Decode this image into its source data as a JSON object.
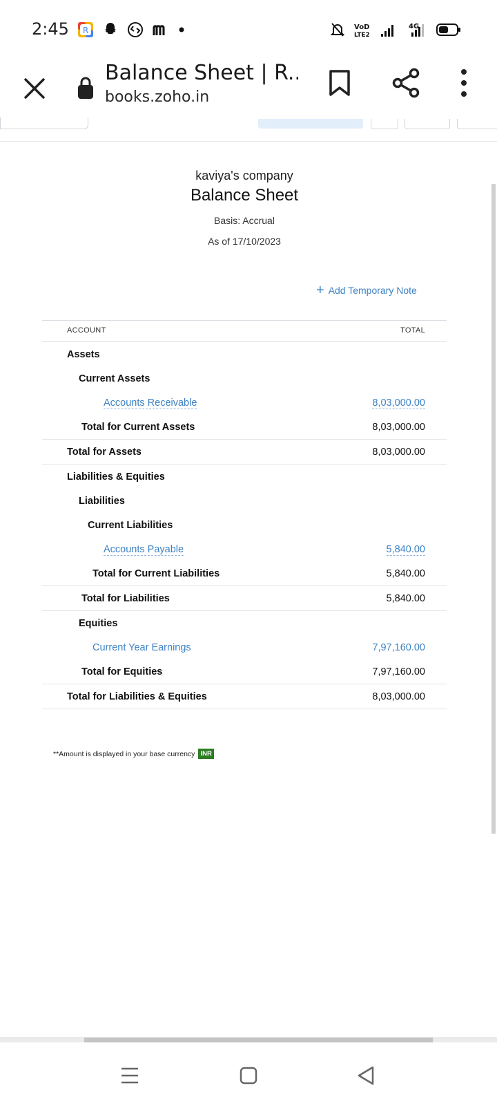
{
  "status_bar": {
    "time": "2:45",
    "left_icons": [
      "app-r-icon",
      "snapchat-icon",
      "shazam-icon",
      "m-app-icon",
      "dot-icon"
    ],
    "right_icons": [
      "bell-muted-icon",
      "volte-icon",
      "signal-icon",
      "4g-signal-icon",
      "battery-icon"
    ],
    "volte_label": "VoD\nLTE2",
    "network_label": "4G"
  },
  "browser": {
    "title": "Balance Sheet | R...",
    "url": "books.zoho.in"
  },
  "report": {
    "company": "kaviya's company",
    "title": "Balance Sheet",
    "basis": "Basis: Accrual",
    "as_of": "As of 17/10/2023",
    "add_note": "Add Temporary Note",
    "columns": {
      "account": "ACCOUNT",
      "total": "TOTAL"
    },
    "rows": {
      "assets": "Assets",
      "current_assets": "Current Assets",
      "accounts_receivable": {
        "label": "Accounts Receivable",
        "amount": "8,03,000.00"
      },
      "total_current_assets": {
        "label": "Total for Current Assets",
        "amount": "8,03,000.00"
      },
      "total_assets": {
        "label": "Total for Assets",
        "amount": "8,03,000.00"
      },
      "liab_eq": "Liabilities & Equities",
      "liabilities": "Liabilities",
      "current_liabilities": "Current Liabilities",
      "accounts_payable": {
        "label": "Accounts Payable",
        "amount": "5,840.00"
      },
      "total_current_liabilities": {
        "label": "Total for Current Liabilities",
        "amount": "5,840.00"
      },
      "total_liabilities": {
        "label": "Total for Liabilities",
        "amount": "5,840.00"
      },
      "equities": "Equities",
      "current_year_earnings": {
        "label": "Current Year Earnings",
        "amount": "7,97,160.00"
      },
      "total_equities": {
        "label": "Total for Equities",
        "amount": "7,97,160.00"
      },
      "total_liab_eq": {
        "label": "Total for Liabilities & Equities",
        "amount": "8,03,000.00"
      }
    },
    "footnote": "**Amount is displayed in your base currency",
    "currency": "INR"
  },
  "colors": {
    "link": "#3d82c4",
    "currency_badge": "#2e7d23"
  }
}
